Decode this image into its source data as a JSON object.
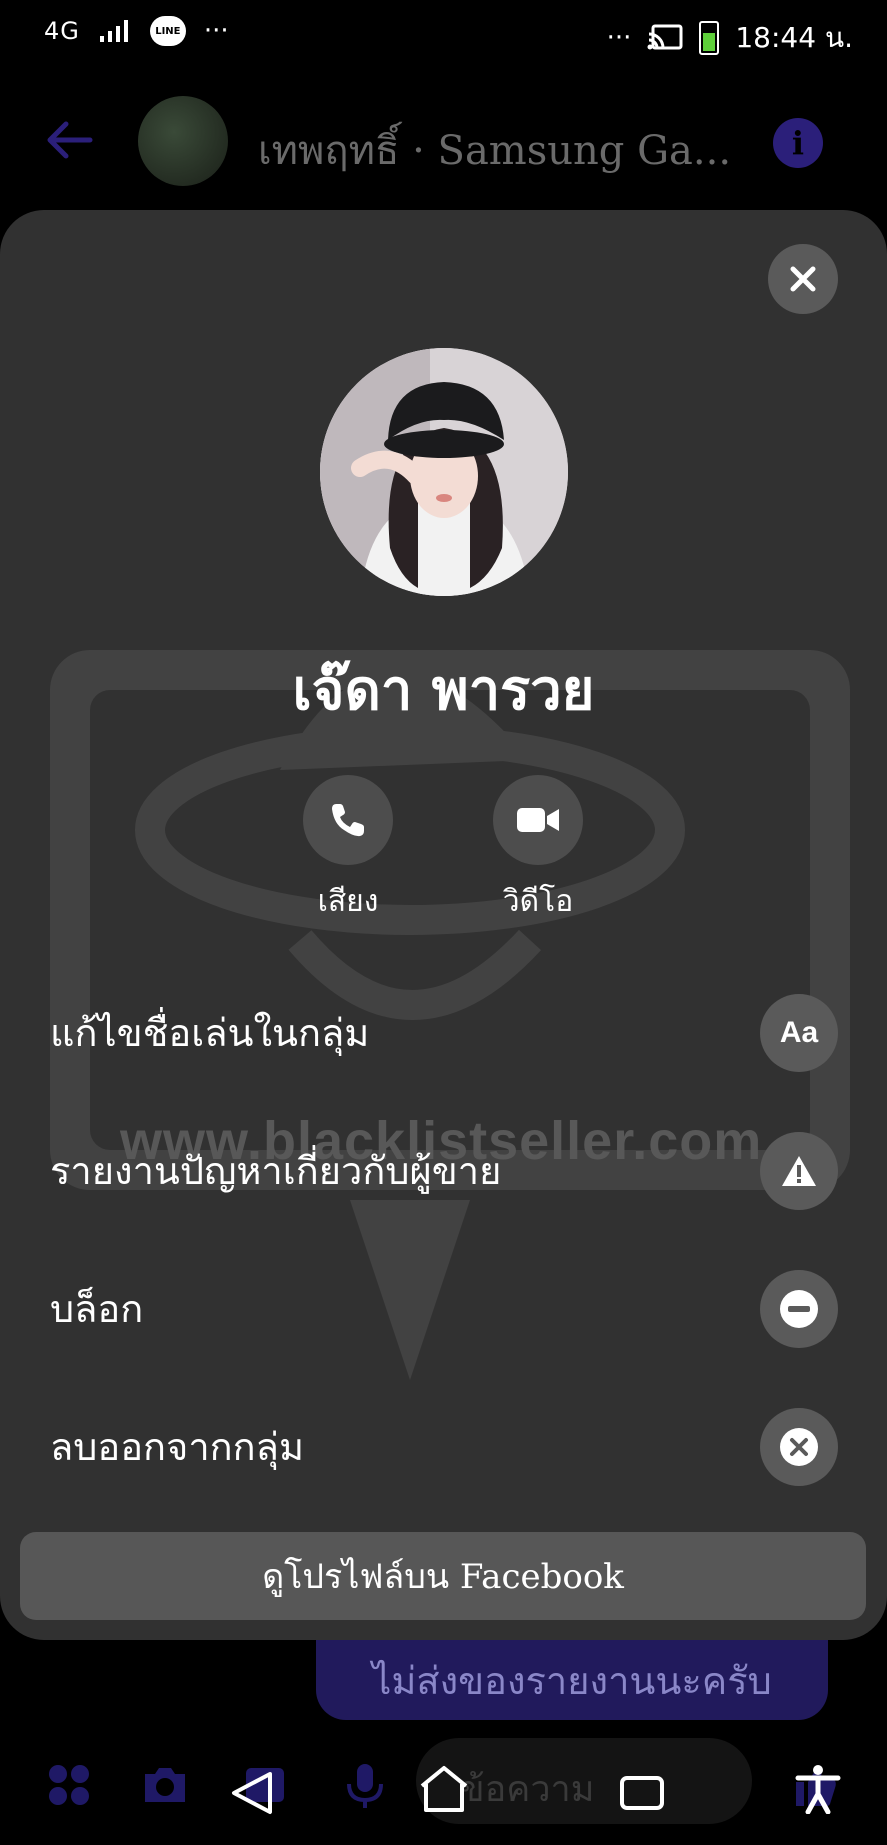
{
  "status_bar": {
    "network": "4G",
    "line_badge": "LINE",
    "dots_left": "···",
    "dots_right": "···",
    "time": "18:44 น."
  },
  "header": {
    "title": "เทพฤทธิ์ · Samsung Ga..."
  },
  "profile": {
    "name": "เจ๊ดา พารวย",
    "audio_label": "เสียง",
    "video_label": "วิดีโอ"
  },
  "actions": [
    {
      "label": "แก้ไขชื่อเล่นในกลุ่ม",
      "icon": "Aa"
    },
    {
      "label": "รายงานปัญหาเกี่ยวกับผู้ขาย",
      "icon": "warning-icon"
    },
    {
      "label": "บล็อก",
      "icon": "block-icon"
    },
    {
      "label": "ลบออกจากกลุ่ม",
      "icon": "remove-icon"
    }
  ],
  "facebook_button": "ดูโปรไฟล์บน Facebook",
  "watermark": "www.blacklistseller.com",
  "chat_bubble": "ไม่ส่งของรายงานนะครับ",
  "composer": {
    "placeholder": "ข้อความ"
  },
  "colors": {
    "sheet_bg": "#313131",
    "button_bg": "#5a5a5a",
    "accent_dim": "#2b1f7a",
    "background": "#000000"
  }
}
